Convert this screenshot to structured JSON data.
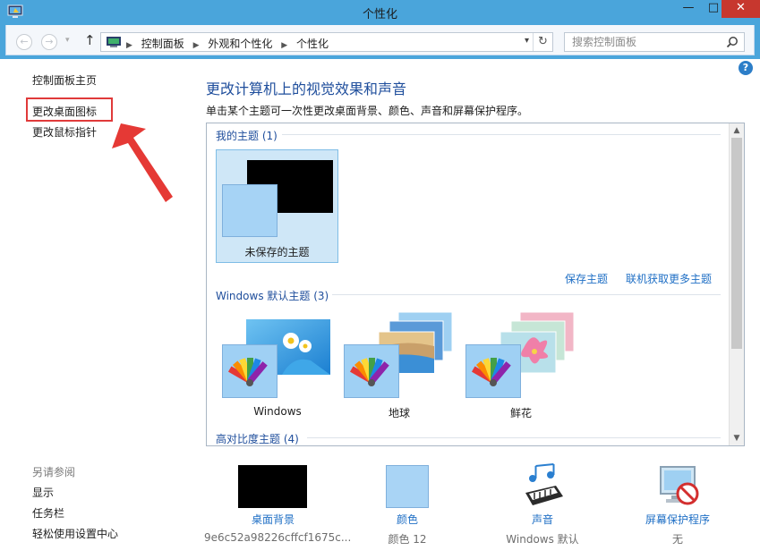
{
  "window": {
    "title": "个性化",
    "minimize": "—",
    "maximize": "□",
    "close": "✕"
  },
  "nav": {
    "back_glyph": "←",
    "forward_glyph": "→",
    "up_glyph": "↑",
    "breadcrumbs": [
      "控制面板",
      "外观和个性化",
      "个性化"
    ],
    "refresh_glyph": "↻",
    "search_placeholder": "搜索控制面板"
  },
  "help_glyph": "?",
  "left": {
    "home": "控制面板主页",
    "desktop_icons": "更改桌面图标",
    "mouse_pointers": "更改鼠标指针",
    "see_also_title": "另请参阅",
    "see_also": [
      "显示",
      "任务栏",
      "轻松使用设置中心"
    ]
  },
  "main": {
    "heading": "更改计算机上的视觉效果和声音",
    "subtitle": "单击某个主题可一次性更改桌面背景、颜色、声音和屏幕保护程序。",
    "my_themes": "我的主题 (1)",
    "unsaved_theme": "未保存的主题",
    "save_theme": "保存主题",
    "get_more": "联机获取更多主题",
    "default_themes": "Windows 默认主题 (3)",
    "themes": [
      "Windows",
      "地球",
      "鲜花"
    ],
    "high_contrast": "高对比度主题 (4)",
    "scroll_up": "▲",
    "scroll_down": "▼"
  },
  "bottom": {
    "desktop_background": {
      "label": "桌面背景",
      "value": "9e6c52a98226cffcf1675c..."
    },
    "color": {
      "label": "颜色",
      "value": "颜色 12"
    },
    "sound": {
      "label": "声音",
      "value": "Windows 默认"
    },
    "screensaver": {
      "label": "屏幕保护程序",
      "value": "无"
    }
  },
  "colors": {
    "titlebar": "#4aa5db",
    "link": "#1f6fc5",
    "heading": "#1f4e9c",
    "highlight_box": "#e03a3a",
    "selection": "#cfe7f7"
  }
}
